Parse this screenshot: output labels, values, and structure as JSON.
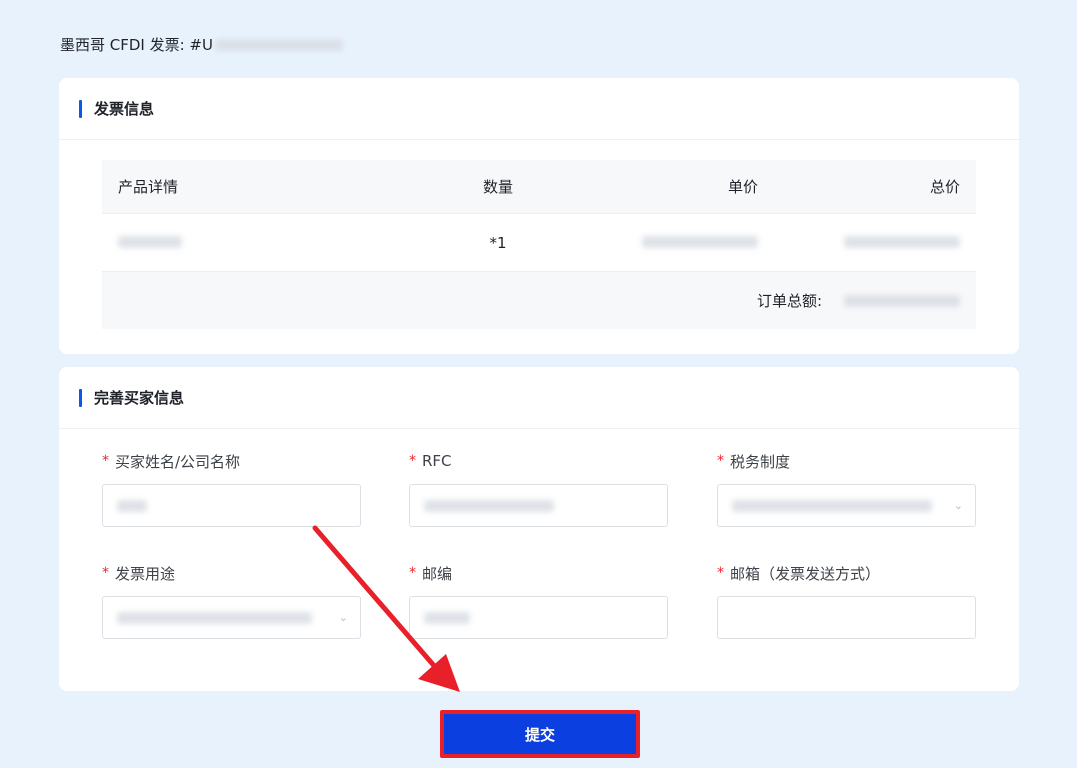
{
  "page": {
    "title_prefix": "墨西哥 CFDI 发票: #",
    "title_suffix": "U"
  },
  "invoice": {
    "section_title": "发票信息",
    "columns": [
      "产品详情",
      "数量",
      "单价",
      "总价"
    ],
    "items": [
      {
        "quantity": "*1"
      }
    ],
    "total_label": "订单总额:"
  },
  "buyer": {
    "section_title": "完善买家信息",
    "fields": [
      {
        "label": "买家姓名/公司名称",
        "required": "*"
      },
      {
        "label": "RFC",
        "required": "*"
      },
      {
        "label": "税务制度",
        "required": "*",
        "type": "select"
      },
      {
        "label": "发票用途",
        "required": "*",
        "type": "select"
      },
      {
        "label": "邮编",
        "required": "*"
      },
      {
        "label": "邮箱（发票发送方式）",
        "required": "*"
      }
    ]
  },
  "actions": {
    "submit_label": "提交"
  },
  "colors": {
    "accent": "#0b57e8",
    "button": "#0b3fe0",
    "highlight": "#e8202a",
    "background": "#e8f2fd"
  }
}
